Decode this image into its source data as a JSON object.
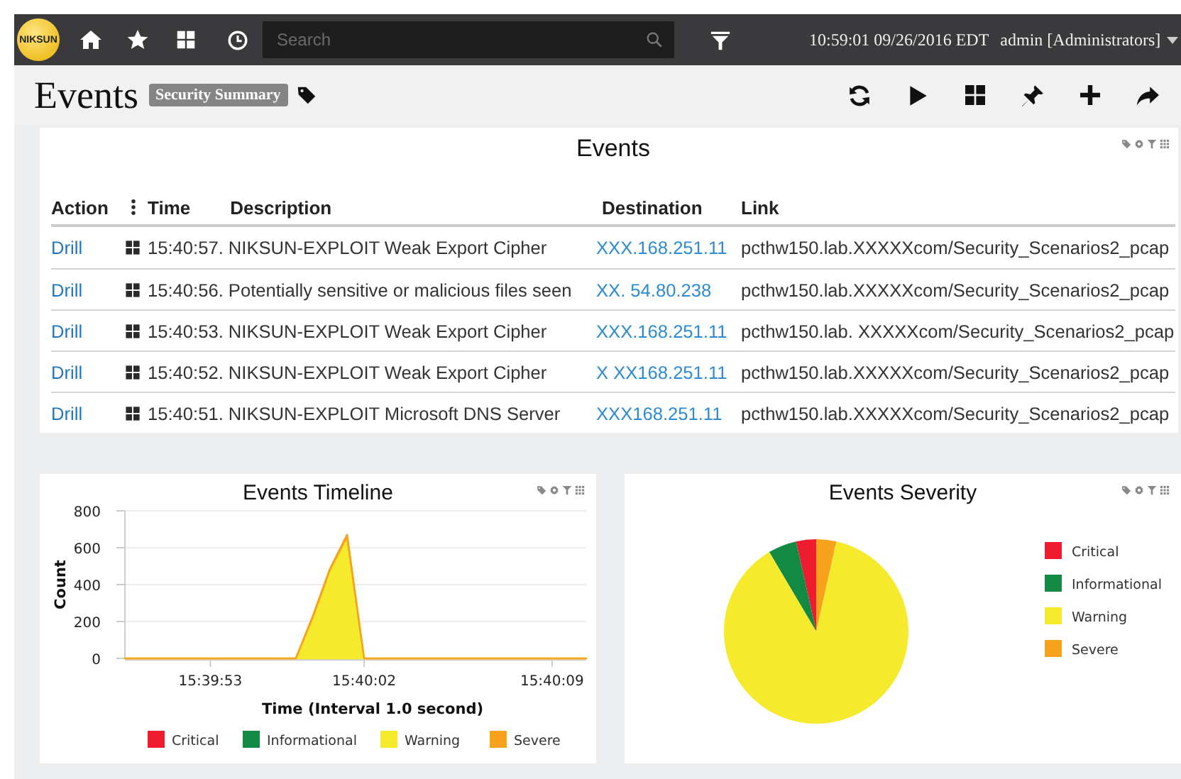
{
  "top_bar": {
    "logo": "NIKSUN",
    "search": {
      "placeholder": "Search"
    },
    "datetime": "10:59:01 09/26/2016 EDT",
    "user": "admin [Administrators]"
  },
  "page_header": {
    "title": "Events",
    "tag": "Security Summary"
  },
  "events_panel": {
    "title": "Events",
    "columns": [
      "Action",
      "Time",
      "Description",
      "Destination",
      "Link"
    ],
    "rows": [
      {
        "action": "Drill",
        "event": "15:40:57. NIKSUN-EXPLOIT Weak Export Cipher",
        "destination": "XXX.168.251.11",
        "link": "pcthw150.lab.XXXXXcom/Security_Scenarios2_pcap"
      },
      {
        "action": "Drill",
        "event": "15:40:56. Potentially sensitive or malicious files seen",
        "destination": "XX. 54.80.238",
        "link": "pcthw150.lab.XXXXXcom/Security_Scenarios2_pcap"
      },
      {
        "action": "Drill",
        "event": "15:40:53. NIKSUN-EXPLOIT Weak Export Cipher",
        "destination": "XXX.168.251.11",
        "link": "pcthw150.lab. XXXXXcom/Security_Scenarios2_pcap"
      },
      {
        "action": "Drill",
        "event": "15:40:52. NIKSUN-EXPLOIT Weak Export Cipher",
        "destination": "X XX168.251.11",
        "link": "pcthw150.lab.XXXXXcom/Security_Scenarios2_pcap"
      },
      {
        "action": "Drill",
        "event": "15:40:51. NIKSUN-EXPLOIT Microsoft DNS Server",
        "destination": "XXX168.251.11",
        "link": "pcthw150.lab.XXXXXcom/Security_Scenarios2_pcap"
      }
    ]
  },
  "timeline_panel": {
    "title": "Events Timeline",
    "chart_data": {
      "type": "area",
      "xlabel": "Time (Interval 1.0 second)",
      "ylabel": "Count",
      "stacked": true,
      "categories": [
        null,
        null,
        null,
        null,
        null,
        "15:39:53",
        null,
        null,
        null,
        null,
        null,
        null,
        null,
        null,
        "15:40:02",
        null,
        null,
        null,
        null,
        null,
        null,
        null,
        null,
        null,
        null,
        "15:40:09",
        null,
        null
      ],
      "ylim": [
        0,
        800
      ],
      "yticks": [
        0,
        200,
        400,
        600,
        800
      ],
      "legend": "bottom",
      "grid": true,
      "series": [
        {
          "name": "Critical",
          "color": "#ee1c2e",
          "values": [
            null,
            null,
            null,
            null,
            null,
            null,
            null,
            null,
            null,
            null,
            null,
            null,
            null,
            null,
            null,
            null,
            null,
            null,
            null,
            null,
            null,
            null,
            null,
            null,
            null,
            null,
            null,
            null
          ]
        },
        {
          "name": "Informational",
          "color": "#138a43",
          "values": [
            null,
            null,
            null,
            null,
            null,
            null,
            null,
            null,
            null,
            null,
            null,
            null,
            null,
            null,
            null,
            null,
            null,
            null,
            null,
            null,
            null,
            null,
            null,
            null,
            null,
            null,
            null,
            null
          ]
        },
        {
          "name": "Warning",
          "color": "#f5ea2c",
          "values": [
            0,
            0,
            0,
            0,
            0,
            0,
            0,
            0,
            0,
            0,
            0,
            225,
            480,
            660,
            0,
            0,
            0,
            0,
            0,
            0,
            0,
            0,
            0,
            0,
            0,
            0,
            0,
            0
          ]
        },
        {
          "name": "Severe",
          "color": "#f7a21d",
          "values": [
            0,
            0,
            0,
            0,
            0,
            0,
            0,
            0,
            0,
            0,
            0,
            5,
            5,
            10,
            0,
            0,
            0,
            0,
            0,
            0,
            0,
            0,
            0,
            0,
            0,
            0,
            0,
            0
          ]
        }
      ]
    }
  },
  "severity_panel": {
    "title": "Events Severity",
    "chart_data": {
      "type": "pie",
      "legend": "right",
      "categories": [
        "Critical",
        "Informational",
        "Warning",
        "Severe"
      ],
      "values": [
        3.5,
        5,
        88,
        3.5
      ],
      "colors": [
        "#ee1c2e",
        "#138a43",
        "#f5ea2c",
        "#f7a21d"
      ]
    }
  }
}
